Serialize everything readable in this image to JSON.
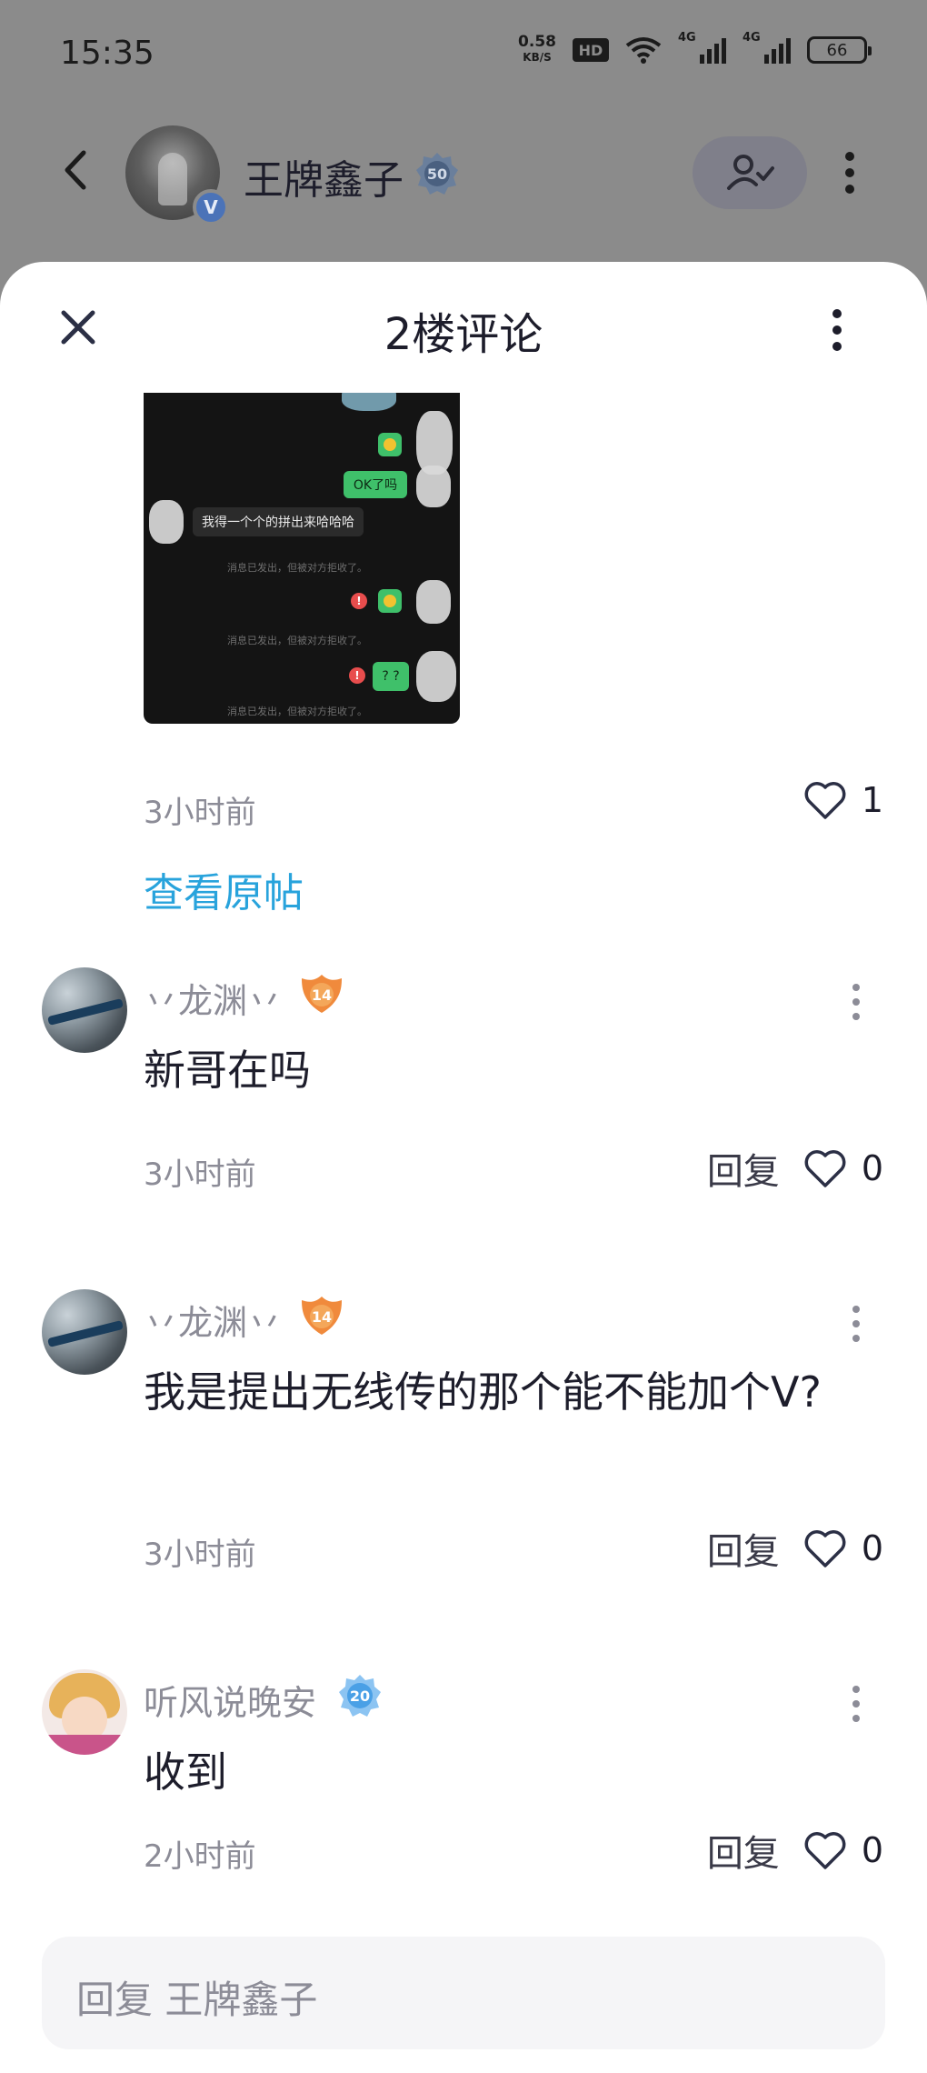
{
  "status_bar": {
    "time": "15:35",
    "net_speed_value": "0.58",
    "net_speed_unit": "KB/S",
    "hd_label": "HD",
    "signal_1_label": "4G",
    "signal_2_label": "4G",
    "battery": "66"
  },
  "host": {
    "name": "王牌鑫子",
    "level": "50",
    "verified_mark": "V"
  },
  "sheet": {
    "title": "2楼评论"
  },
  "post": {
    "image": {
      "bubble_ok": "OK了吗",
      "gray_msg": "我得一个个的拼出来哈哈哈",
      "rejected_note": "消息已发出，但被对方拒收了。",
      "bubble_qq": "? ?",
      "err_mark": "!"
    },
    "time": "3小时前",
    "likes": "1",
    "view_original": "查看原帖"
  },
  "comments": [
    {
      "name": "丷龙渊丷",
      "level": "14",
      "text": "新哥在吗",
      "time": "3小时前",
      "reply_label": "回复",
      "likes": "0"
    },
    {
      "name": "丷龙渊丷",
      "level": "14",
      "text": "我是提出无线传的那个能不能加个V?",
      "time": "3小时前",
      "reply_label": "回复",
      "likes": "0"
    },
    {
      "name": "听风说晚安",
      "level": "20",
      "text": "收到",
      "time": "2小时前",
      "reply_label": "回复",
      "likes": "0"
    }
  ],
  "reply_input": {
    "placeholder": "回复 王牌鑫子"
  },
  "colors": {
    "accent_link": "#28a3dc",
    "level_orange": "#f08a3c",
    "level_blue": "#4aa0e6"
  }
}
